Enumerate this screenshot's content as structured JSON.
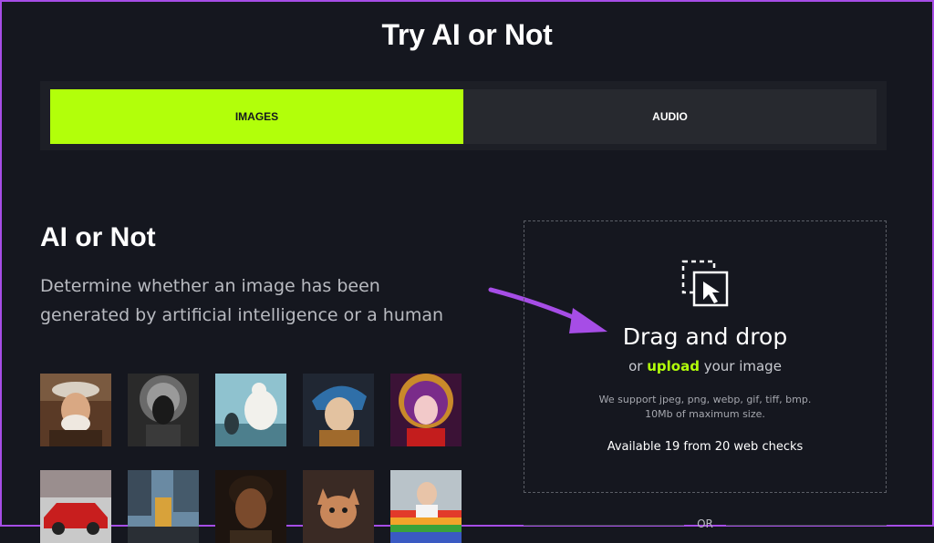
{
  "header": {
    "title": "Try AI or Not"
  },
  "tabs": [
    {
      "label": "IMAGES",
      "active": true
    },
    {
      "label": "AUDIO",
      "active": false
    }
  ],
  "hero": {
    "title": "AI or Not",
    "description": "Determine whether an image has been generated by artificial intelligence or a human"
  },
  "samples": [
    {
      "name": "sample-old-man"
    },
    {
      "name": "sample-alien-queen"
    },
    {
      "name": "sample-polar-bear"
    },
    {
      "name": "sample-pearl-earring"
    },
    {
      "name": "sample-anime-girl"
    },
    {
      "name": "sample-red-car"
    },
    {
      "name": "sample-city-scene"
    },
    {
      "name": "sample-woman-portrait"
    },
    {
      "name": "sample-cat"
    },
    {
      "name": "sample-pope"
    }
  ],
  "dropzone": {
    "title": "Drag and drop",
    "sub_prefix": "or",
    "upload_label": "upload",
    "sub_suffix": "your image",
    "formats_line1": "We support jpeg, png, webp, gif, tiff, bmp.",
    "formats_line2": "10Mb of maximum size.",
    "checks": "Available 19 from 20 web checks"
  },
  "separator": {
    "label": "OR"
  },
  "colors": {
    "accent": "#b2ff0a",
    "annotation_arrow": "#a64de6",
    "background": "#15171f"
  }
}
